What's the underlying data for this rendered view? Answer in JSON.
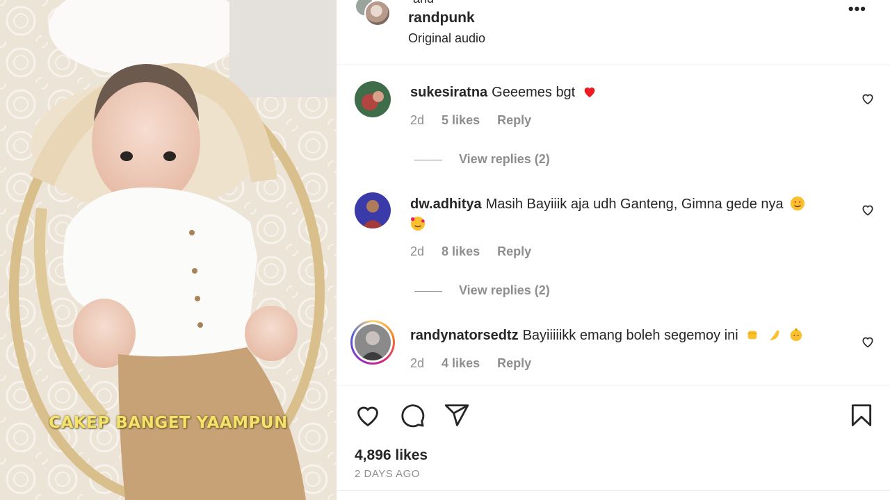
{
  "media": {
    "overlay_text": "CAKEP BANGET YAAMPUN"
  },
  "post": {
    "top_clipped_text": "and",
    "author": "randpunk",
    "audio": "Original audio",
    "more_icon": "more-horizontal-icon"
  },
  "comments": [
    {
      "username": "sukesiratna",
      "text": "Geeemes bgt",
      "emojis": [
        "red-heart"
      ],
      "age": "2d",
      "likes": "5 likes",
      "reply_label": "Reply",
      "view_replies": "View replies (2)"
    },
    {
      "username": "dw.adhitya",
      "text": "Masih Bayiiik aja udh Ganteng, Gimna gede nya",
      "emojis": [
        "heart-eyes",
        "smiling-face-with-hearts"
      ],
      "age": "2d",
      "likes": "8 likes",
      "reply_label": "Reply",
      "view_replies": "View replies (2)"
    },
    {
      "username": "randynatorsedtz",
      "text": "Bayiiiiikk emang boleh segemoy ini",
      "emojis": [
        "raised-fist",
        "flexed-arm",
        "baby"
      ],
      "age": "2d",
      "likes": "4 likes",
      "reply_label": "Reply"
    }
  ],
  "actions": {
    "icons": [
      "heart-icon",
      "comment-icon",
      "share-icon",
      "bookmark-icon"
    ]
  },
  "stats": {
    "likes": "4,896 likes",
    "time_ago": "2 DAYS AGO"
  },
  "colors": {
    "text": "#262626",
    "secondary": "#8e8e8e",
    "heart_red": "#ed1c24",
    "overlay_yellow": "#f5e26b"
  }
}
